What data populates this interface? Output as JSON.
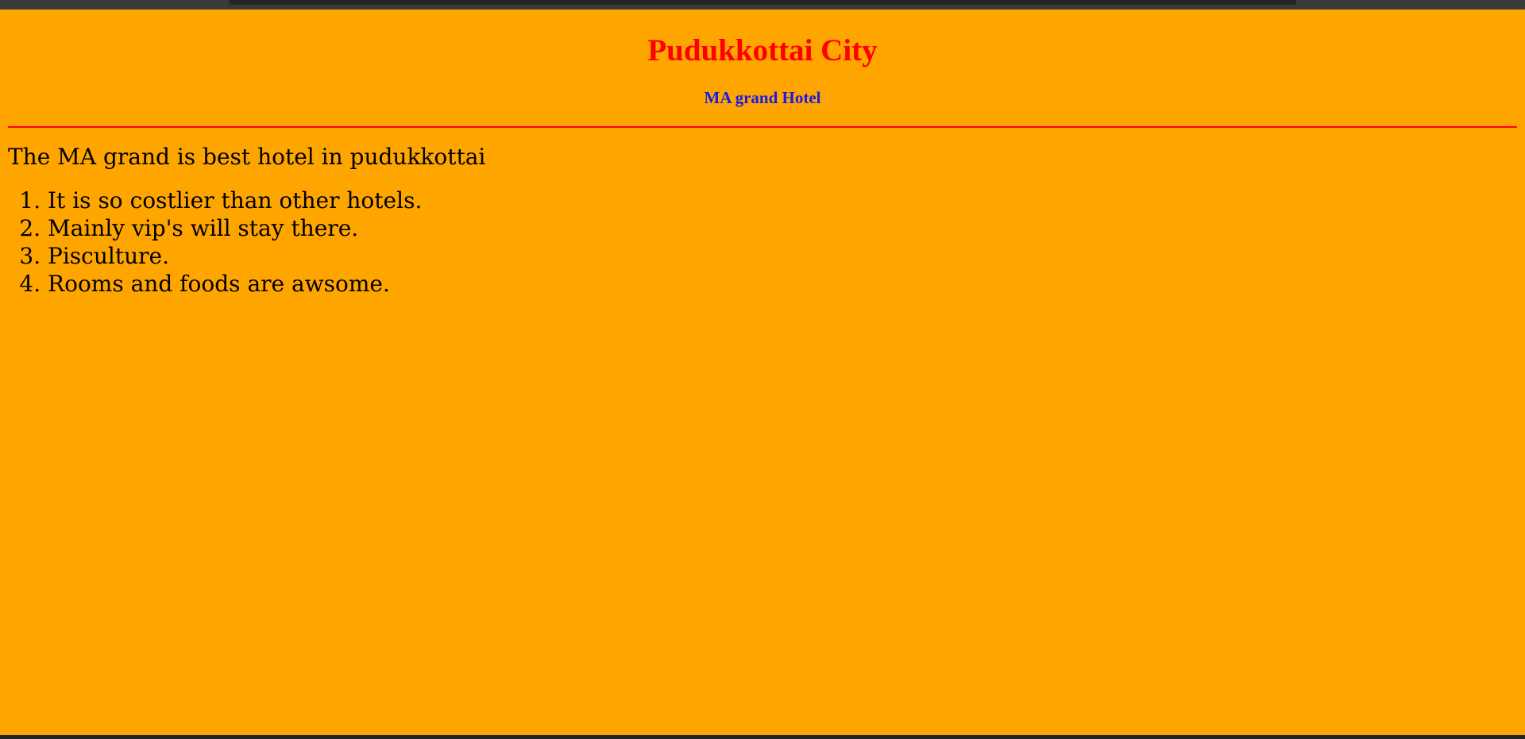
{
  "page": {
    "background_color": "#ffa500",
    "title": "Pudukkottai City",
    "title_color": "#ff0000",
    "subtitle": "MA grand Hotel",
    "subtitle_color": "#1a1ae6",
    "divider_color": "#ff0000",
    "intro": "The MA grand is best hotel in pudukkottai",
    "list_items": [
      "It is so costlier than other hotels.",
      "Mainly vip's will stay there.",
      "Pisculture.",
      "Rooms and foods are awsome."
    ]
  }
}
